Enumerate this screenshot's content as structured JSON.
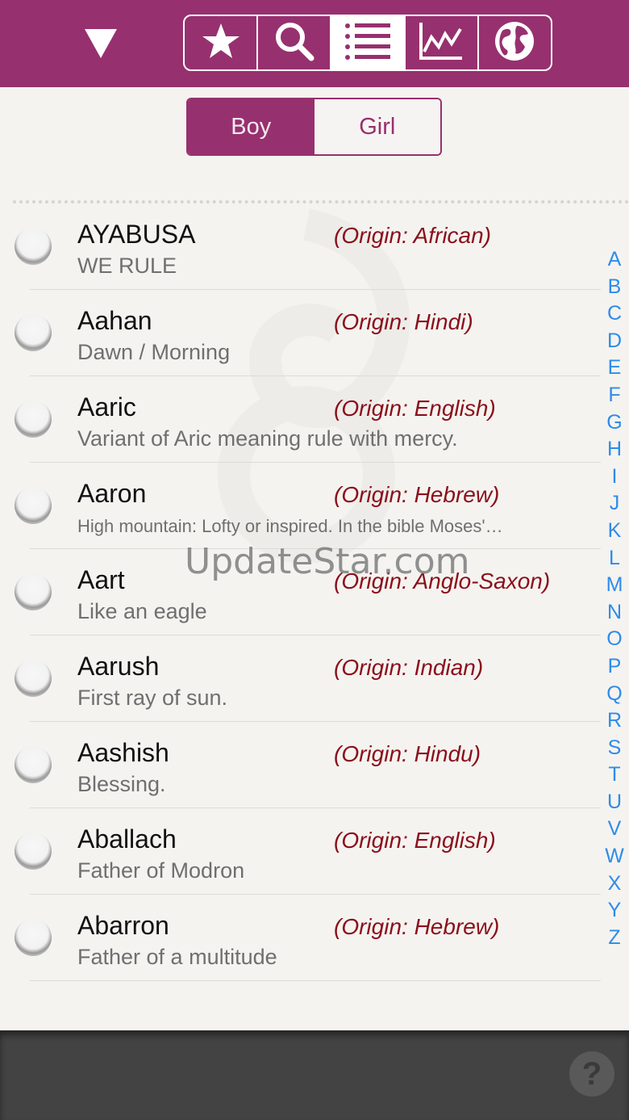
{
  "toolbar": {
    "dropdown_icon": "triangle-down-icon",
    "tabs": [
      {
        "icon": "star-icon"
      },
      {
        "icon": "search-icon"
      },
      {
        "icon": "list-icon",
        "active": true
      },
      {
        "icon": "chart-icon"
      },
      {
        "icon": "globe-icon"
      }
    ]
  },
  "gender": {
    "boy": "Boy",
    "girl": "Girl",
    "selected": "Boy"
  },
  "names": [
    {
      "name": "AYABUSA",
      "origin": "(Origin: African)",
      "meaning": "WE RULE"
    },
    {
      "name": "Aahan",
      "origin": "(Origin: Hindi)",
      "meaning": "Dawn / Morning"
    },
    {
      "name": "Aaric",
      "origin": "(Origin: English)",
      "meaning": "Variant of Aric meaning rule with mercy."
    },
    {
      "name": "Aaron",
      "origin": "(Origin: Hebrew)",
      "meaning": "High mountain: Lofty or inspired. In the bible Moses'…"
    },
    {
      "name": "Aart",
      "origin": "(Origin: Anglo-Saxon)",
      "meaning": "Like an eagle"
    },
    {
      "name": "Aarush",
      "origin": "(Origin: Indian)",
      "meaning": "First ray of sun."
    },
    {
      "name": "Aashish",
      "origin": "(Origin: Hindu)",
      "meaning": "Blessing."
    },
    {
      "name": "Aballach",
      "origin": "(Origin: English)",
      "meaning": "Father of Modron"
    },
    {
      "name": "Abarron",
      "origin": "(Origin: Hebrew)",
      "meaning": "Father of a multitude"
    }
  ],
  "alphabet": [
    "A",
    "B",
    "C",
    "D",
    "E",
    "F",
    "G",
    "H",
    "I",
    "J",
    "K",
    "L",
    "M",
    "N",
    "O",
    "P",
    "Q",
    "R",
    "S",
    "T",
    "U",
    "V",
    "W",
    "X",
    "Y",
    "Z"
  ],
  "watermark": "UpdateStar.com",
  "help_label": "?",
  "colors": {
    "accent": "#97306f",
    "origin": "#8b0f1a",
    "index": "#2f8be8"
  }
}
